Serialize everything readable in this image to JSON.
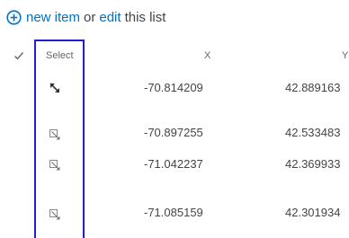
{
  "toolbar": {
    "new_item_label": "new item",
    "or_label": "or",
    "edit_label": "edit",
    "this_list_label": "this list"
  },
  "columns": {
    "select": "Select",
    "x": "X",
    "y": "Y"
  },
  "rows": [
    {
      "x": "-70.814209",
      "y": "42.889163"
    },
    {
      "x": "-70.897255",
      "y": "42.533483"
    },
    {
      "x": "-71.042237",
      "y": "42.369933"
    },
    {
      "x": "-71.085159",
      "y": "42.301934"
    }
  ],
  "icons": {
    "add": "plus-circle-icon",
    "header_check": "checkmark-icon",
    "row_edit": "edit-item-icon"
  },
  "colors": {
    "link": "#0072c6",
    "highlight_border": "#1f1fd8"
  }
}
